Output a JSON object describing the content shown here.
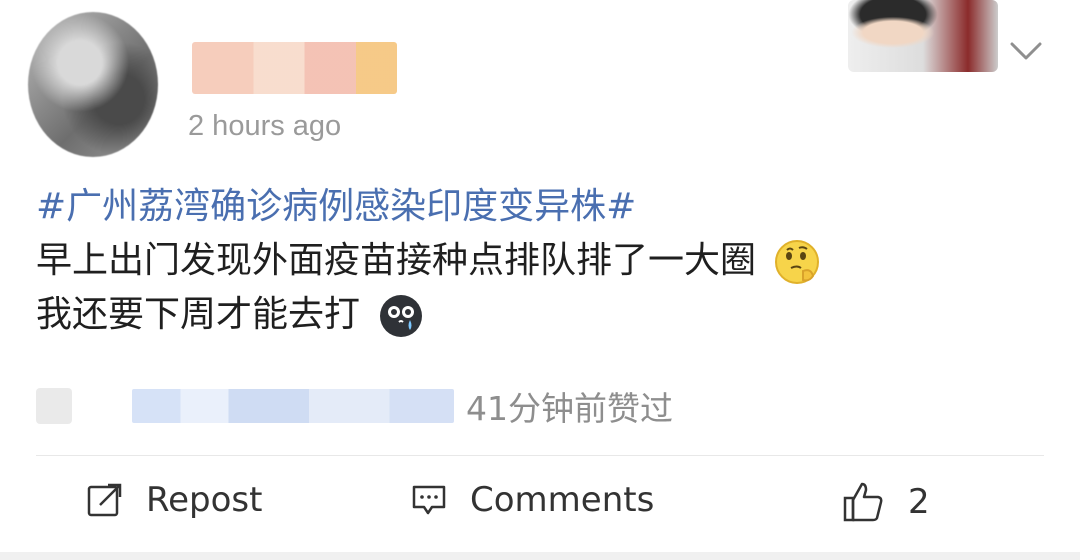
{
  "post": {
    "time": "2 hours ago",
    "hashtag": "#广州荔湾确诊病例感染印度变异株#",
    "line1": "早上出门发现外面疫苗接种点排队排了一大圈",
    "line2": "我还要下周才能去打",
    "liked_suffix": "41分钟前赞过"
  },
  "actions": {
    "repost_label": "Repost",
    "comments_label": "Comments",
    "like_count": "2"
  },
  "icons": {
    "repost": "repost-icon",
    "comments": "comment-icon",
    "like": "thumbs-up-icon",
    "menu": "chevron-down-icon"
  },
  "colors": {
    "hashtag": "#4a6fb0",
    "secondary_text": "#9a9a9a",
    "primary_text": "#1f1f1f"
  }
}
